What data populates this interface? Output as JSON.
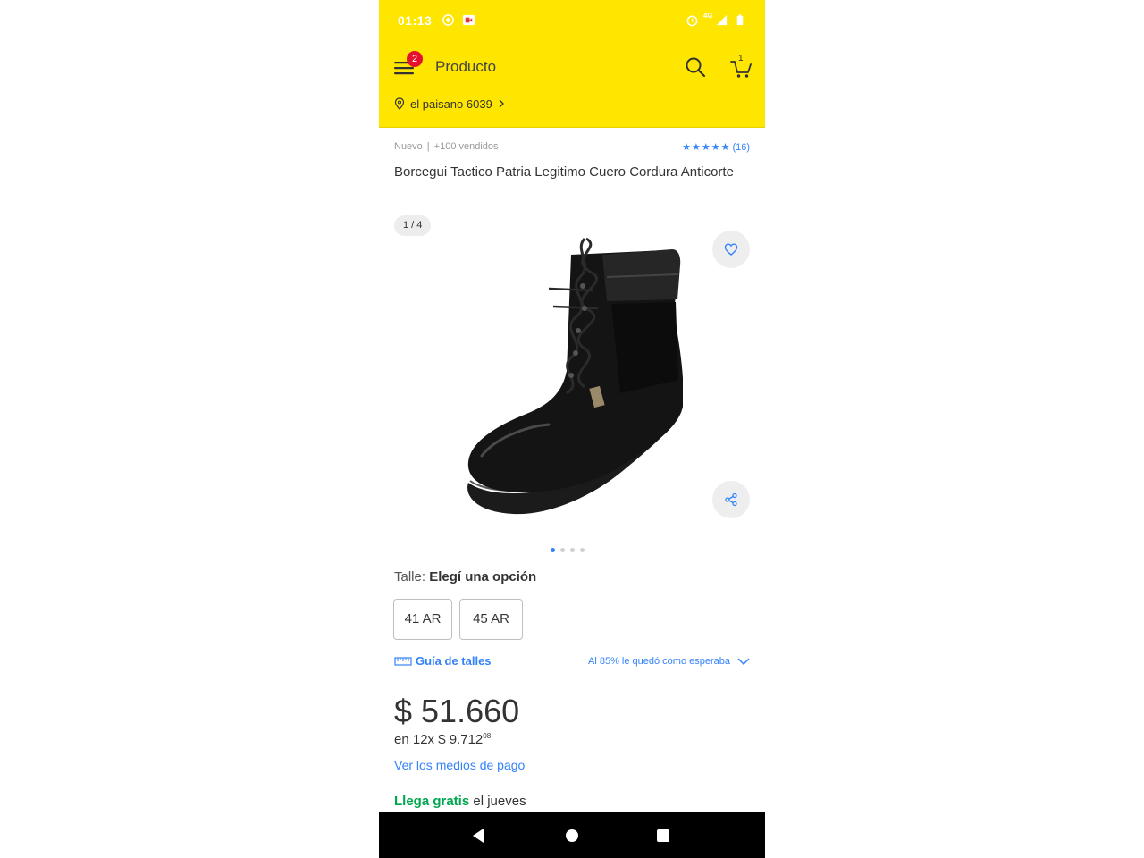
{
  "status_bar": {
    "time": "01:13",
    "network": "4G",
    "icons": [
      "record-icon",
      "video-call-icon",
      "alarm-icon",
      "signal-icon",
      "battery-icon"
    ]
  },
  "header": {
    "menu_badge": "2",
    "title": "Producto",
    "cart_count": "1",
    "location": "el paisano 6039",
    "background_color": "#fee600"
  },
  "product": {
    "condition": "Nuevo",
    "sold": "+100 vendidos",
    "rating_count": "(16)",
    "rating_stars": 5,
    "title": "Borcegui Tactico  Patria Legitimo  Cuero Cordura Anticorte",
    "image_counter": "1 / 4",
    "gallery_total": 4,
    "gallery_active": 1
  },
  "size": {
    "label": "Talle:",
    "prompt": "Elegí una opción",
    "options": [
      "41 AR",
      "45 AR"
    ],
    "guide_link": "Guía de talles",
    "fit_text": "Al 85% le quedó como esperaba"
  },
  "price": {
    "amount": "$ 51.660",
    "installments_prefix": "en 12x $ 9.712",
    "installments_cents": "08",
    "payment_link": "Ver los medios de pago"
  },
  "shipping": {
    "free_label": "Llega gratis",
    "day": "el jueves",
    "free_color": "#00a650"
  },
  "colors": {
    "accent": "#3483fa",
    "badge": "#e5112e"
  }
}
